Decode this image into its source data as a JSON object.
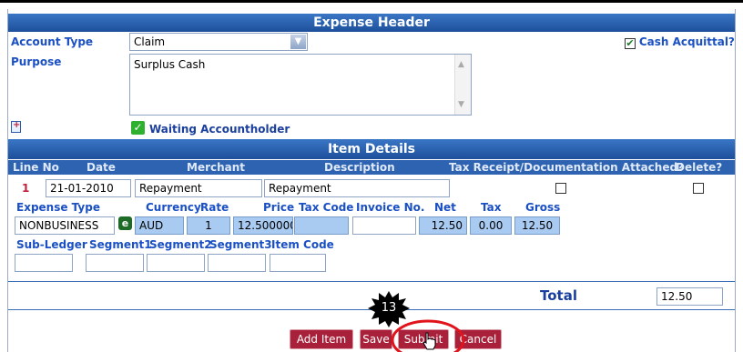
{
  "expense_header": {
    "title": "Expense Header",
    "account_type_label": "Account Type",
    "account_type_value": "Claim",
    "cash_acquittal_label": "Cash Acquittal?",
    "cash_acquittal_checked": true,
    "purpose_label": "Purpose",
    "purpose_value": "Surplus Cash",
    "status_text": "Waiting Accountholder"
  },
  "item_details": {
    "title": "Item Details",
    "columns": [
      "Line No",
      "Date",
      "Merchant",
      "Description",
      "Tax Receipt/Documentation Attached?",
      "Delete?"
    ],
    "row": {
      "line_no": "1",
      "date": "21-01-2010",
      "merchant": "Repayment",
      "description": "Repayment"
    },
    "sub_columns": [
      "Expense Type",
      "Currency",
      "Rate",
      "Price",
      "Tax Code",
      "Invoice No.",
      "Net",
      "Tax",
      "Gross"
    ],
    "values": {
      "expense_type": "NONBUSINESS",
      "currency": "AUD",
      "rate": "1",
      "price": "12.5000000",
      "tax_code": "",
      "invoice_no": "",
      "net": "12.50",
      "tax": "0.00",
      "gross": "12.50"
    },
    "segment_columns": [
      "Sub-Ledger",
      "Segment1",
      "Segment2",
      "Segment3",
      "Item Code"
    ]
  },
  "total": {
    "label": "Total",
    "value": "12.50"
  },
  "buttons": {
    "add_item": "Add Item",
    "save": "Save",
    "submit": "Submit",
    "cancel": "Cancel"
  },
  "annotation": {
    "step": "13",
    "highlight_color": "#e0141a"
  },
  "colors": {
    "header_blue": "#2a5fae",
    "label_blue": "#1a50c4",
    "button_red": "#a8203a",
    "field_blue": "#a9cbf2"
  }
}
